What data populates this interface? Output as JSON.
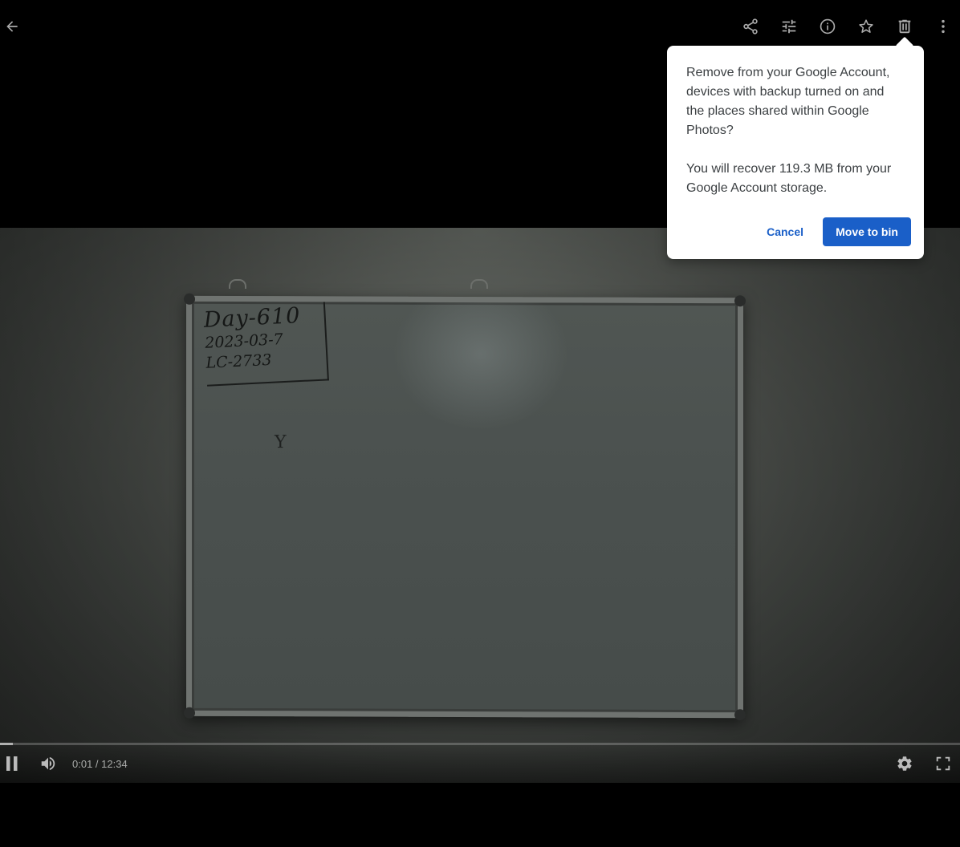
{
  "toolbar": {
    "icons": [
      "back-arrow-icon",
      "share-icon",
      "edit-adjust-icon",
      "info-icon",
      "star-icon",
      "trash-icon",
      "more-vert-icon"
    ]
  },
  "delete_dialog": {
    "message": "Remove from your Google Account, devices with backup turned on and the places shared within Google Photos?",
    "storage_note": "You will recover 119.3 MB from your Google Account storage.",
    "cancel_label": "Cancel",
    "confirm_label": "Move to bin"
  },
  "video": {
    "whiteboard_text": {
      "line1": "Day-610",
      "line2": "2023-03-7",
      "line3": "LC-2733"
    },
    "current_time": "0:01",
    "duration": "12:34",
    "time_display": "0:01 / 12:34",
    "progress_fraction": 0.0013
  },
  "colors": {
    "accent": "#1a5fc8",
    "toolbar_icon": "#aaaaaa",
    "dialog_text": "#3c4043"
  }
}
